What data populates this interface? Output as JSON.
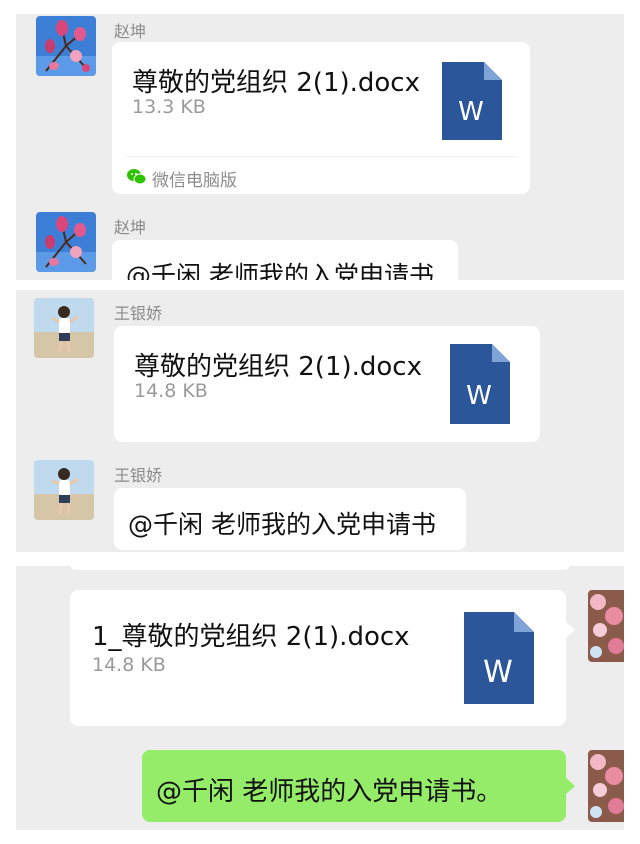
{
  "panel1": {
    "messages": [
      {
        "sender": "赵坤",
        "file_name": "尊敬的党组织 2(1).docx",
        "file_size": "13.3 KB",
        "source": "微信电脑版"
      },
      {
        "sender": "赵坤",
        "text": "@千闲  老师我的入党申请书"
      }
    ]
  },
  "panel2": {
    "messages": [
      {
        "sender": "王银娇",
        "file_name": "尊敬的党组织 2(1).docx",
        "file_size": "14.8 KB"
      },
      {
        "sender": "王银娇",
        "text": "@千闲  老师我的入党申请书"
      }
    ]
  },
  "panel3": {
    "messages": [
      {
        "file_name": "1_尊敬的党组织 2(1).docx",
        "file_size": "14.8 KB"
      },
      {
        "text": "@千闲  老师我的入党申请书。"
      }
    ]
  },
  "icons": {
    "doc": "word-document-icon",
    "wechat": "wechat-logo-icon"
  },
  "colors": {
    "panel_bg": "#ededed",
    "bubble": "#ffffff",
    "sent_bubble": "#95ec69",
    "word_blue": "#2b579a",
    "name_gray": "#8c8c8c"
  }
}
